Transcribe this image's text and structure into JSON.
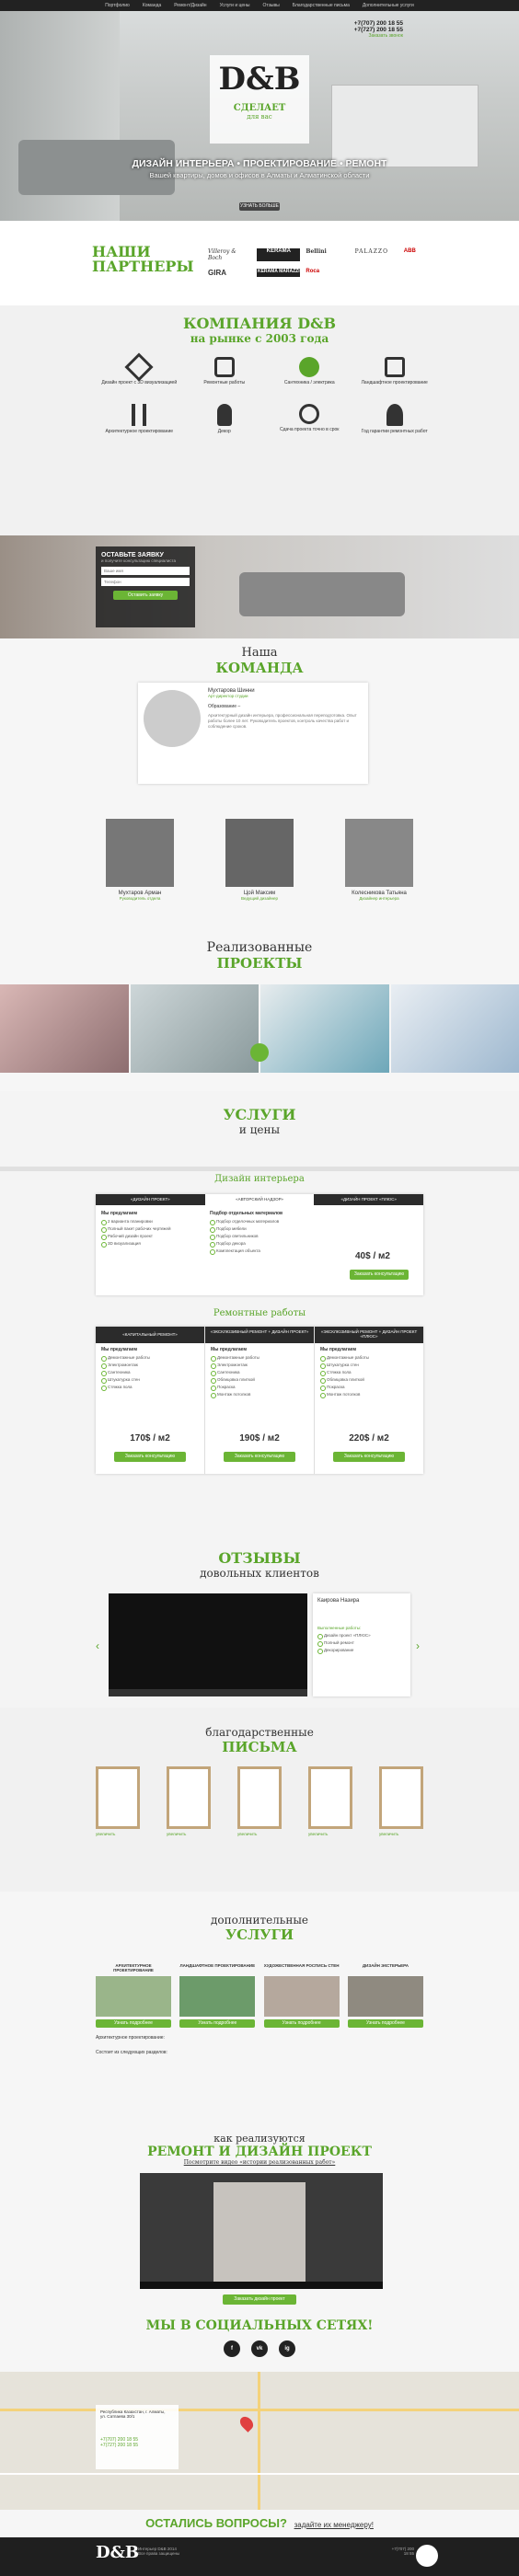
{
  "nav": [
    "Портфолио",
    "Команда",
    "Ремонт/Дизайн",
    "Услуги и цены",
    "Отзывы",
    "Благодарственные письма",
    "Дополнительные услуги"
  ],
  "hero": {
    "logo": "D&B",
    "phone1": "+7(707) 200 18 55",
    "phone2": "+7(727) 200 18 55",
    "callback": "Заказать звонок",
    "cta1": "СДЕЛАЕТ",
    "cta2": "для вас",
    "headline": "ДИЗАЙН ИНТЕРЬЕРА • ПРОЕКТИРОВАНИЕ • РЕМОНТ",
    "sub": "Вашей квартиры, домов и офисов в Алматы и Алматинской области",
    "btn": "УЗНАТЬ БОЛЬШЕ"
  },
  "partners": {
    "title1": "НАШИ",
    "title2": "ПАРТНЕРЫ",
    "logos": [
      "Villeroy & Boch",
      "KERAMA",
      "GIRA",
      "Bellini",
      "PALAZZO",
      "KERAMA MARAZZI",
      "ABB",
      "Roca"
    ]
  },
  "company": {
    "title1": "КОМПАНИЯ D&B",
    "title2": "на рынке с 2003 года",
    "features": [
      "Дизайн проект с 3D визуализацией",
      "Ремонтные работы",
      "Сантехника / электрика",
      "Ландшафтное проектирование",
      "Архитектурное проектирование",
      "Декор",
      "Сдача проекта точно в срок",
      "Год гарантии ремонтных работ"
    ]
  },
  "form": {
    "title": "ОСТАВЬТЕ ЗАЯВКУ",
    "sub": "и получите консультацию специалиста",
    "name": "Ваше имя",
    "phone": "Телефон",
    "btn": "Оставить заявку"
  },
  "team": {
    "t1": "Наша",
    "t2": "КОМАНДА",
    "lead": {
      "name": "Мухтарова Шинни",
      "role": "Арт-директор студии",
      "edu": "Образование –",
      "text": "Архитектурный дизайн интерьера, профессиональная переподготовка. Опыт работы более 10 лет. Руководитель проектов, контроль качества работ и соблюдение сроков."
    },
    "members": [
      {
        "name": "Мухтаров Арман",
        "role": "Руководитель отдела"
      },
      {
        "name": "Цой Максим",
        "role": "Ведущий дизайнер"
      },
      {
        "name": "Колесникова Татьяна",
        "role": "Дизайнер интерьера"
      }
    ]
  },
  "projects": {
    "t1": "Реализованные",
    "t2": "ПРОЕКТЫ"
  },
  "services": {
    "t1": "УСЛУГИ",
    "t2": "и цены",
    "design": "Дизайн интерьера",
    "tabs": [
      "«ДИЗАЙН ПРОЕКТ»",
      "«АВТОРСКИЙ НАДЗОР»",
      "«ДИЗАЙН ПРОЕКТ «ПЛЮС»"
    ],
    "we": "Мы предлагаем",
    "choose": "Подбор отдельных материалов",
    "items": [
      "2 варианта планировки",
      "Полный пакет рабочих чертежей",
      "Рабочий дизайн проект",
      "3D визуализация"
    ],
    "items2": [
      "Подбор отделочных материалов",
      "Подбор мебели",
      "Подбор светильников",
      "Подбор декора",
      "Комплектация объекта"
    ],
    "price1": "40$ / м2",
    "cons": "Заказать консультацию",
    "repair": "Ремонтные работы",
    "rtabs": [
      "«КАПИТАЛЬНЫЙ РЕМОНТ»",
      "«ЭКСКЛЮЗИВНЫЙ РЕМОНТ + ДИЗАЙН ПРОЕКТ»",
      "«ЭКСКЛЮЗИВНЫЙ РЕМОНТ + ДИЗАЙН ПРОЕКТ «ПЛЮС»"
    ],
    "ritems": [
      "Демонтажные работы",
      "Электромонтаж",
      "Сантехника",
      "Штукатурка стен",
      "Стяжка пола",
      "Облицовка плиткой",
      "Покраска",
      "Монтаж потолков"
    ],
    "prices": [
      "170$ / м2",
      "190$ / м2",
      "220$ / м2"
    ]
  },
  "reviews": {
    "t1": "ОТЗЫВЫ",
    "t2": "довольных клиентов",
    "name": "Каирова Назира",
    "sub": "Выполненные работы:",
    "items": [
      "Дизайн проект «ПЛЮС»",
      "Полный ремонт",
      "Декорирование"
    ]
  },
  "letters": {
    "t1": "благодарственные",
    "t2": "ПИСЬМА",
    "cap": "увеличить"
  },
  "extra": {
    "t1": "дополнительные",
    "t2": "УСЛУГИ",
    "items": [
      "АРХИТЕКТУРНОЕ ПРОЕКТИРОВАНИЕ",
      "ЛАНДШАФТНОЕ ПРОЕКТИРОВАНИЕ",
      "ХУДОЖЕСТВЕННАЯ РОСПИСЬ СТЕН",
      "ДИЗАЙН ЭКСТЕРЬЕРА"
    ],
    "btn": "Узнать подробнее",
    "d1": "Архитектурное проектирование:",
    "d2": "Состоит из следующих разделов:"
  },
  "video": {
    "t1": "как реализуются",
    "t2": "РЕМОНТ И ДИЗАЙН ПРОЕКТ",
    "sub": "Посмотрите видео «истории реализованных работ»",
    "btn": "Заказать дизайн проект"
  },
  "social": {
    "title": "МЫ В СОЦИАЛЬНЫХ СЕТЯХ!",
    "icons": [
      "f",
      "vk",
      "ig"
    ]
  },
  "map": {
    "addr1": "Республика Казахстан, г. Алматы,",
    "addr2": "ул. Сатпаева 30/1",
    "ph1": "+7(707) 200 18 55",
    "ph2": "+7(727) 200 18 55"
  },
  "footer": {
    "question": "ОСТАЛИСЬ ВОПРОСЫ?",
    "ask": "задайте их менеджеру!",
    "copy": "Интерьер D&B 2014",
    "studio": "Все права защищены"
  },
  "colors": {
    "accent": "#6bb535",
    "dark": "#222222"
  }
}
